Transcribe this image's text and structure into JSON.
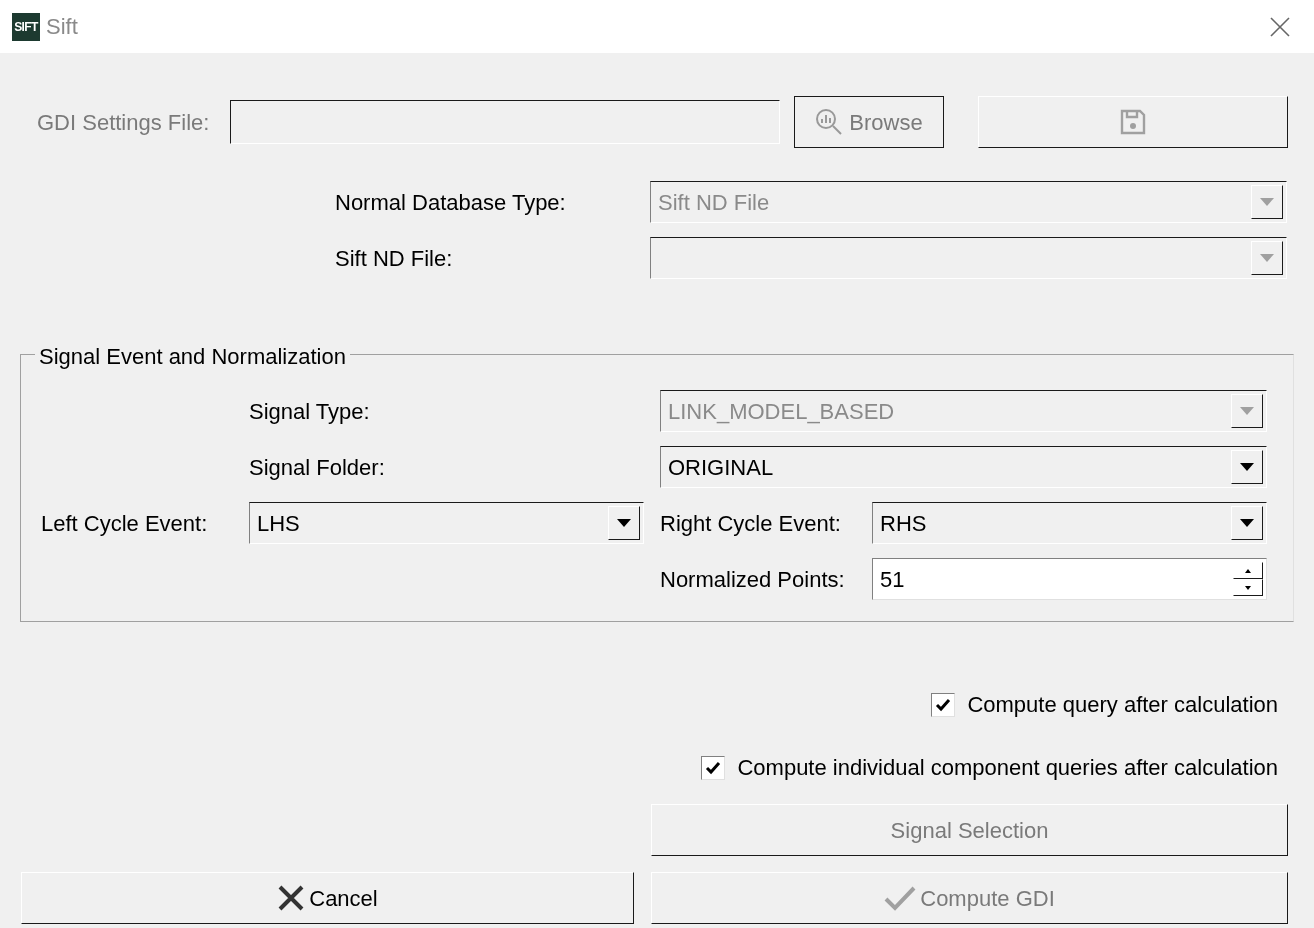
{
  "window": {
    "title": "Sift",
    "app_icon_text": "SIFT"
  },
  "settings_file": {
    "label": "GDI Settings File:",
    "label_disabled": true,
    "browse": {
      "label": "Browse",
      "disabled": true
    },
    "save_disabled": true
  },
  "database_fields": [
    {
      "label": "Normal Database Type:",
      "value": "Sift ND File",
      "disabled": true
    },
    {
      "label": "Sift ND File:",
      "disabled": true
    }
  ],
  "signal_group": {
    "title": "Signal Event and Normalization",
    "signal_type": {
      "label": "Signal Type:",
      "value": "LINK_MODEL_BASED",
      "disabled": true
    },
    "signal_folder": {
      "label": "Signal Folder:",
      "value": "ORIGINAL",
      "disabled": false
    },
    "left_cycle_event": {
      "label": "Left Cycle Event:",
      "value": "LHS",
      "disabled": false
    },
    "right_cycle_event": {
      "label": "Right Cycle Event:",
      "value": "RHS",
      "disabled": false
    },
    "normalized_points": {
      "label": "Normalized Points:",
      "value": "51"
    }
  },
  "options": [
    {
      "label": "Compute query after calculation",
      "checked": true
    },
    {
      "label": "Compute individual component queries after calculation",
      "checked": true
    }
  ],
  "signal_selection": {
    "label": "Signal Selection",
    "disabled": true
  },
  "buttons": [
    {
      "kind": "cancel",
      "label": "Cancel",
      "disabled": false
    },
    {
      "kind": "compute",
      "label": "Compute GDI",
      "disabled": true
    }
  ]
}
